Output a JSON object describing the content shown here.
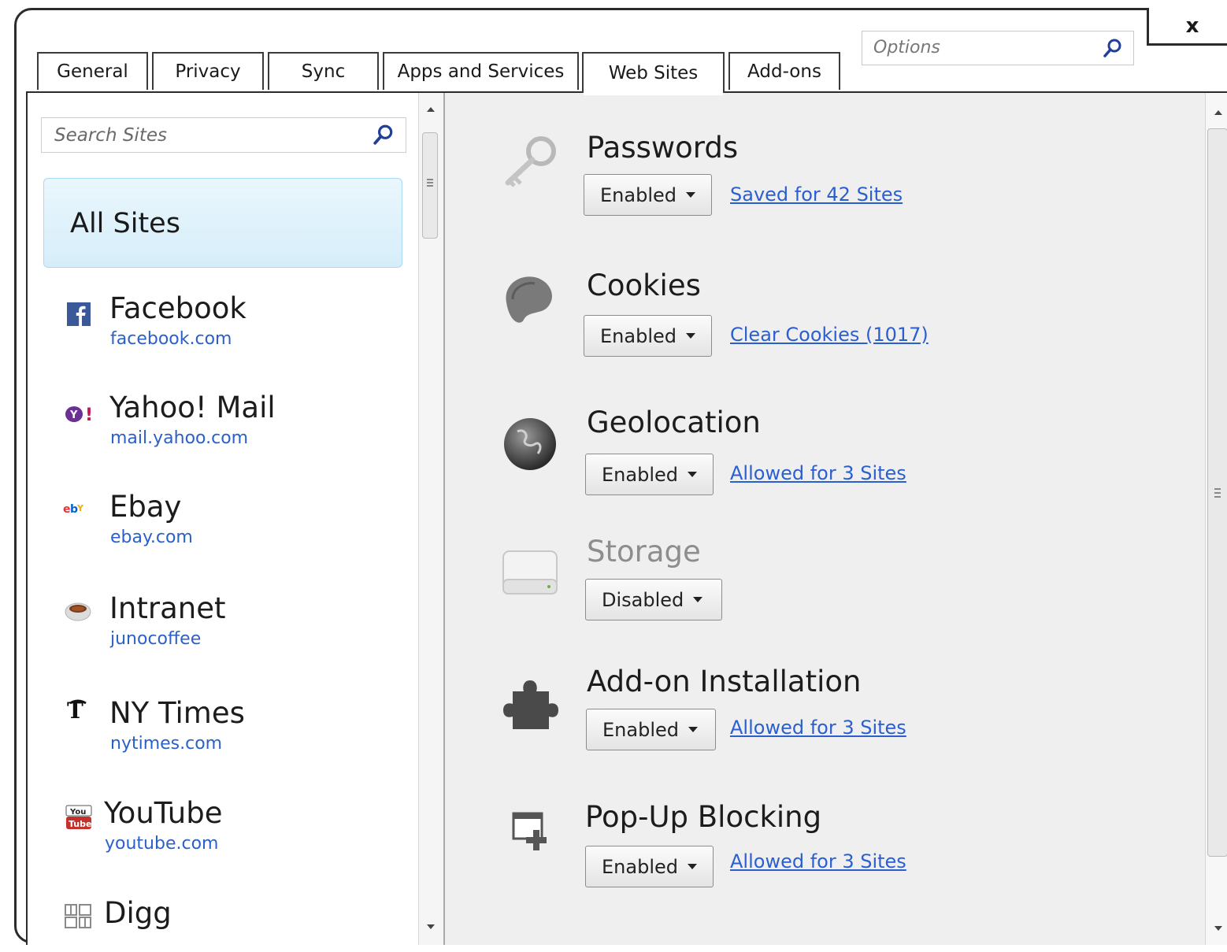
{
  "window": {
    "close_label": "x"
  },
  "tabs": [
    {
      "label": "General"
    },
    {
      "label": "Privacy"
    },
    {
      "label": "Sync"
    },
    {
      "label": "Apps and Services"
    },
    {
      "label": "Web Sites",
      "active": true
    },
    {
      "label": "Add-ons"
    }
  ],
  "options_search": {
    "placeholder": "Options"
  },
  "sites_search": {
    "placeholder": "Search Sites"
  },
  "all_sites": {
    "label": "All Sites"
  },
  "sites": [
    {
      "name": "Facebook",
      "url": "facebook.com",
      "icon": "facebook-icon"
    },
    {
      "name": "Yahoo! Mail",
      "url": "mail.yahoo.com",
      "icon": "yahoo-icon"
    },
    {
      "name": "Ebay",
      "url": "ebay.com",
      "icon": "ebay-icon"
    },
    {
      "name": "Intranet",
      "url": "junocoffee",
      "icon": "coffee-cup-icon"
    },
    {
      "name": "NY Times",
      "url": "nytimes.com",
      "icon": "nytimes-icon"
    },
    {
      "name": "YouTube",
      "url": "youtube.com",
      "icon": "youtube-icon"
    },
    {
      "name": "Digg",
      "url": "",
      "icon": "digg-icon"
    }
  ],
  "settings": [
    {
      "title": "Passwords",
      "state": "Enabled",
      "link": "Saved for 42 Sites",
      "icon": "key-icon"
    },
    {
      "title": "Cookies",
      "state": "Enabled",
      "link": "Clear Cookies (1017)",
      "icon": "cookie-icon"
    },
    {
      "title": "Geolocation",
      "state": "Enabled",
      "link": "Allowed for 3 Sites",
      "icon": "globe-icon"
    },
    {
      "title": "Storage",
      "state": "Disabled",
      "link": "",
      "icon": "hard-drive-icon"
    },
    {
      "title": "Add-on Installation",
      "state": "Enabled",
      "link": "Allowed for 3 Sites",
      "icon": "puzzle-piece-icon"
    },
    {
      "title": "Pop-Up Blocking",
      "state": "Enabled",
      "link": "Allowed for 3 Sites",
      "icon": "popup-window-icon"
    }
  ],
  "colors": {
    "link": "#2b5fd0",
    "selection": "#d6eefa",
    "pane_background": "#efefef"
  }
}
